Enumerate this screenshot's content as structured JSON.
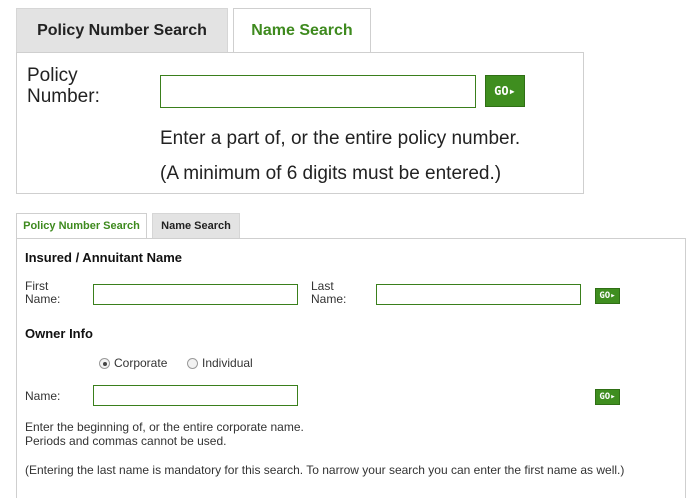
{
  "panel_large": {
    "tabs": [
      "Policy Number Search",
      "Name Search"
    ],
    "active_tab": "Name Search",
    "field_label": "Policy Number:",
    "field_value": "",
    "go_label": "GO▸",
    "help_line1": "Enter a part of, or the entire policy number.",
    "help_line2": "(A minimum of 6 digits must be entered.)"
  },
  "panel_small": {
    "tabs": [
      "Policy Number Search",
      "Name Search"
    ],
    "active_tab": "Policy Number Search",
    "insured_heading": "Insured / Annuitant Name",
    "first_name_label": "First Name:",
    "first_name_value": "",
    "last_name_label": "Last Name:",
    "last_name_value": "",
    "go_label": "GO▸",
    "owner_heading": "Owner Info",
    "owner_type_options": [
      "Corporate",
      "Individual"
    ],
    "owner_type_selected": "Corporate",
    "name_label": "Name:",
    "name_value": "",
    "help_line1": "Enter the beginning of, or the entire corporate name.",
    "help_line2": "Periods and commas cannot be used.",
    "note": "(Entering the last name is mandatory for this search. To narrow your search you can enter the first name as well.)"
  },
  "colors": {
    "accent_green": "#3f8e1f",
    "tab_inactive_bg": "#e3e3e3",
    "border": "#cfcfcf"
  }
}
